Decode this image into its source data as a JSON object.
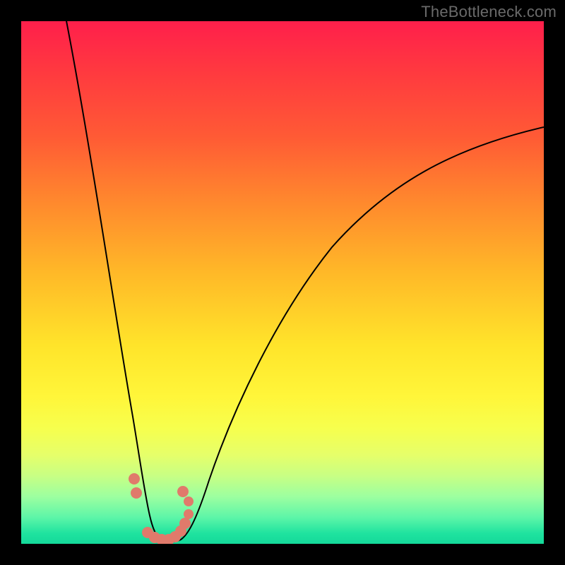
{
  "watermark": "TheBottleneck.com",
  "colors": {
    "frame": "#000000",
    "gradient_top": "#ff1f4b",
    "gradient_mid": "#ffe42a",
    "gradient_bottom": "#14d99a",
    "curve": "#000000",
    "markers": "#e07a6b"
  },
  "chart_data": {
    "type": "line",
    "title": "",
    "xlabel": "",
    "ylabel": "",
    "xlim": [
      0,
      100
    ],
    "ylim": [
      0,
      100
    ],
    "grid": false,
    "legend": false,
    "x": [
      0,
      2,
      4,
      6,
      8,
      10,
      12,
      14,
      16,
      18,
      19,
      20,
      21,
      22,
      23,
      24,
      25,
      26,
      27,
      28,
      29,
      30,
      32,
      34,
      36,
      38,
      40,
      44,
      48,
      52,
      56,
      60,
      66,
      72,
      78,
      84,
      90,
      96,
      100
    ],
    "y": [
      120,
      110,
      100,
      90,
      80,
      70,
      60,
      50,
      40,
      30,
      25,
      20,
      15,
      10,
      6,
      3,
      1,
      0,
      0,
      1,
      2,
      5,
      10,
      16,
      22,
      28,
      33,
      42,
      50,
      56,
      62,
      67,
      73,
      78,
      82,
      85,
      88,
      90,
      91
    ],
    "markers": [
      {
        "x": 20.5,
        "y": 12
      },
      {
        "x": 21,
        "y": 9
      },
      {
        "x": 28.5,
        "y": 9.5
      },
      {
        "x": 29.5,
        "y": 8
      }
    ],
    "marker_cluster": [
      {
        "x": 23,
        "y": 1
      },
      {
        "x": 24,
        "y": 0.5
      },
      {
        "x": 25,
        "y": 0.3
      },
      {
        "x": 26,
        "y": 0.3
      },
      {
        "x": 27,
        "y": 0.5
      },
      {
        "x": 28,
        "y": 1
      },
      {
        "x": 28.5,
        "y": 2
      },
      {
        "x": 29,
        "y": 3.5
      }
    ]
  }
}
